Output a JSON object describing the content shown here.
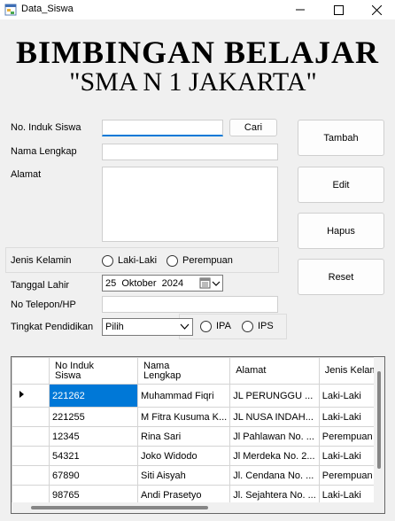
{
  "window": {
    "title": "Data_Siswa"
  },
  "banner": {
    "line1": "BIMBINGAN BELAJAR",
    "line2": "\"SMA N 1 JAKARTA\""
  },
  "form": {
    "nis_label": "No. Induk Siswa",
    "nis_value": "",
    "cari_label": "Cari",
    "nama_label": "Nama Lengkap",
    "nama_value": "",
    "alamat_label": "Alamat",
    "alamat_value": "",
    "jk_label": "Jenis Kelamin",
    "jk_options": [
      "Laki-Laki",
      "Perempuan"
    ],
    "tgl_label": "Tanggal Lahir",
    "tgl_value": "25  Oktober  2024",
    "telp_label": "No Telepon/HP",
    "telp_value": "",
    "pend_label": "Tingkat Pendidikan",
    "pend_value": "Pilih",
    "jurusan_options": [
      "IPA",
      "IPS"
    ]
  },
  "buttons": {
    "tambah": "Tambah",
    "edit": "Edit",
    "hapus": "Hapus",
    "reset": "Reset"
  },
  "grid": {
    "headers": [
      "No Induk\nSiswa",
      "Nama\nLengkap",
      "Alamat",
      "Jenis Kelam"
    ],
    "rows": [
      [
        "221262",
        "Muhammad Fiqri",
        "JL PERUNGGU ...",
        "Laki-Laki"
      ],
      [
        "221255",
        "M Fitra Kusuma K...",
        "JL NUSA INDAH...",
        "Laki-Laki"
      ],
      [
        "12345",
        "Rina Sari",
        "Jl Pahlawan No. ...",
        "Perempuan"
      ],
      [
        "54321",
        "Joko Widodo",
        "Jl Merdeka No. 2...",
        "Laki-Laki"
      ],
      [
        "67890",
        "Siti Aisyah",
        "Jl. Cendana No. ...",
        "Perempuan"
      ],
      [
        "98765",
        "Andi Prasetyo",
        "Jl. Sejahtera No. ...",
        "Laki-Laki"
      ]
    ],
    "selected_row": 0
  },
  "colors": {
    "accent": "#0078d7",
    "background": "#f0f0f0"
  }
}
